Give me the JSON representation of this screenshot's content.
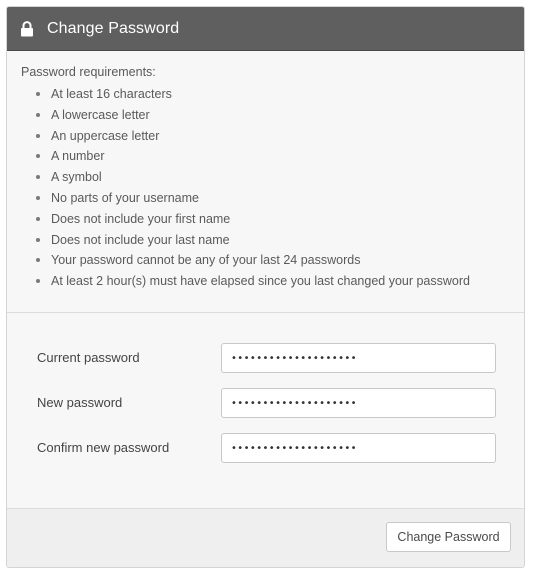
{
  "header": {
    "icon": "lock-icon",
    "title": "Change Password"
  },
  "requirements": {
    "title": "Password requirements:",
    "items": [
      "At least 16 characters",
      "A lowercase letter",
      "An uppercase letter",
      "A number",
      "A symbol",
      "No parts of your username",
      "Does not include your first name",
      "Does not include your last name",
      "Your password cannot be any of your last 24 passwords",
      "At least 2 hour(s) must have elapsed since you last changed your password"
    ]
  },
  "form": {
    "current": {
      "label": "Current password",
      "value": "••••••••••••••••••••"
    },
    "new": {
      "label": "New password",
      "value": "••••••••••••••••••••"
    },
    "confirm": {
      "label": "Confirm new password",
      "value": "••••••••••••••••••••"
    }
  },
  "footer": {
    "submit_label": "Change Password"
  },
  "colors": {
    "header_bg": "#5f5f5f",
    "panel_bg": "#f7f7f7",
    "footer_bg": "#efefef"
  }
}
